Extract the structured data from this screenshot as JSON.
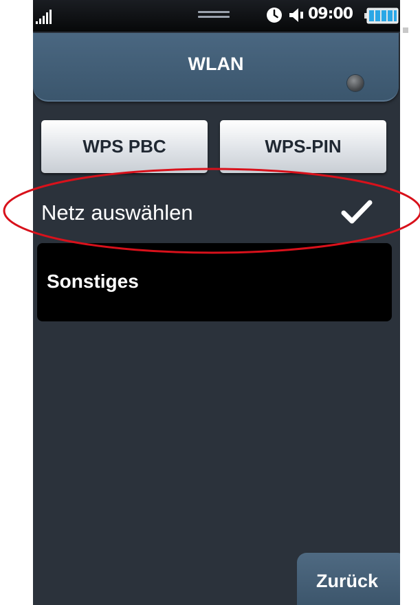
{
  "status_bar": {
    "time": "09:00",
    "icons": [
      "signal-icon",
      "drag-handle-icon",
      "clock-icon",
      "speaker-icon",
      "battery-icon"
    ]
  },
  "header": {
    "title": "WLAN"
  },
  "buttons": {
    "wps_pbc": "WPS PBC",
    "wps_pin": "WPS-PIN",
    "back": "Zurück"
  },
  "list": {
    "items": [
      {
        "label": "Netz auswählen",
        "checked": true
      },
      {
        "label": "Sonstiges",
        "checked": false
      }
    ]
  },
  "colors": {
    "background": "#2b323b",
    "title_bar": "#44607a",
    "annotation": "#d8111b",
    "battery": "#2aa7e6"
  }
}
